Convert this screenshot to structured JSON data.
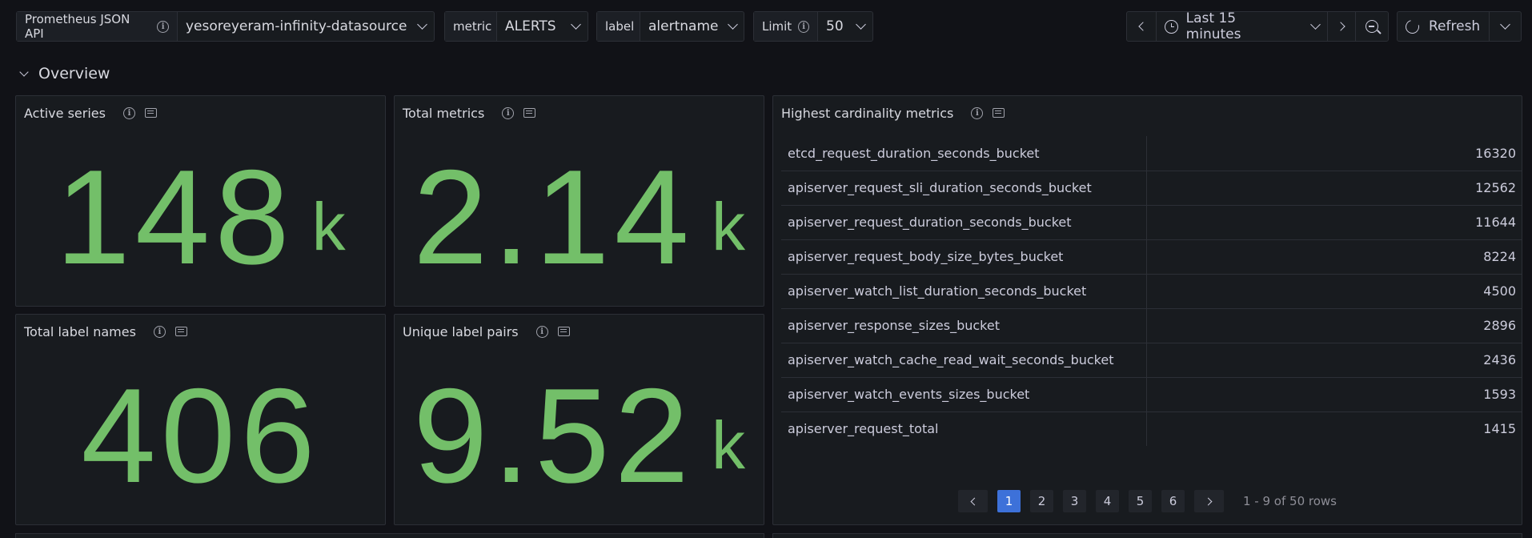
{
  "variables": {
    "datasource": {
      "label": "Prometheus JSON API",
      "value": "yesoreyeram-infinity-datasource"
    },
    "metric": {
      "label": "metric",
      "value": "ALERTS"
    },
    "label": {
      "label": "label",
      "value": "alertname"
    },
    "limit": {
      "label": "Limit",
      "value": "50"
    }
  },
  "time_range": {
    "label": "Last 15 minutes"
  },
  "refresh": {
    "label": "Refresh"
  },
  "row": {
    "title": "Overview"
  },
  "panels": {
    "active_series": {
      "title": "Active series",
      "value": "148",
      "unit": "k"
    },
    "total_metrics": {
      "title": "Total metrics",
      "value": "2.14",
      "unit": "k"
    },
    "total_label_names": {
      "title": "Total label names",
      "value": "406",
      "unit": ""
    },
    "unique_label_pairs": {
      "title": "Unique label pairs",
      "value": "9.52",
      "unit": "k"
    },
    "highest_cardinality": {
      "title": "Highest cardinality metrics",
      "rows": [
        {
          "name": "etcd_request_duration_seconds_bucket",
          "value": "16320"
        },
        {
          "name": "apiserver_request_sli_duration_seconds_bucket",
          "value": "12562"
        },
        {
          "name": "apiserver_request_duration_seconds_bucket",
          "value": "11644"
        },
        {
          "name": "apiserver_request_body_size_bytes_bucket",
          "value": "8224"
        },
        {
          "name": "apiserver_watch_list_duration_seconds_bucket",
          "value": "4500"
        },
        {
          "name": "apiserver_response_sizes_bucket",
          "value": "2896"
        },
        {
          "name": "apiserver_watch_cache_read_wait_seconds_bucket",
          "value": "2436"
        },
        {
          "name": "apiserver_watch_events_sizes_bucket",
          "value": "1593"
        },
        {
          "name": "apiserver_request_total",
          "value": "1415"
        }
      ],
      "pagination": {
        "pages": [
          "1",
          "2",
          "3",
          "4",
          "5",
          "6"
        ],
        "current": "1",
        "info": "1 - 9 of 50 rows"
      }
    }
  },
  "colors": {
    "stat_green": "#73bf69",
    "page_active": "#3d71d9",
    "background": "#111217",
    "panel": "#181b1f"
  }
}
